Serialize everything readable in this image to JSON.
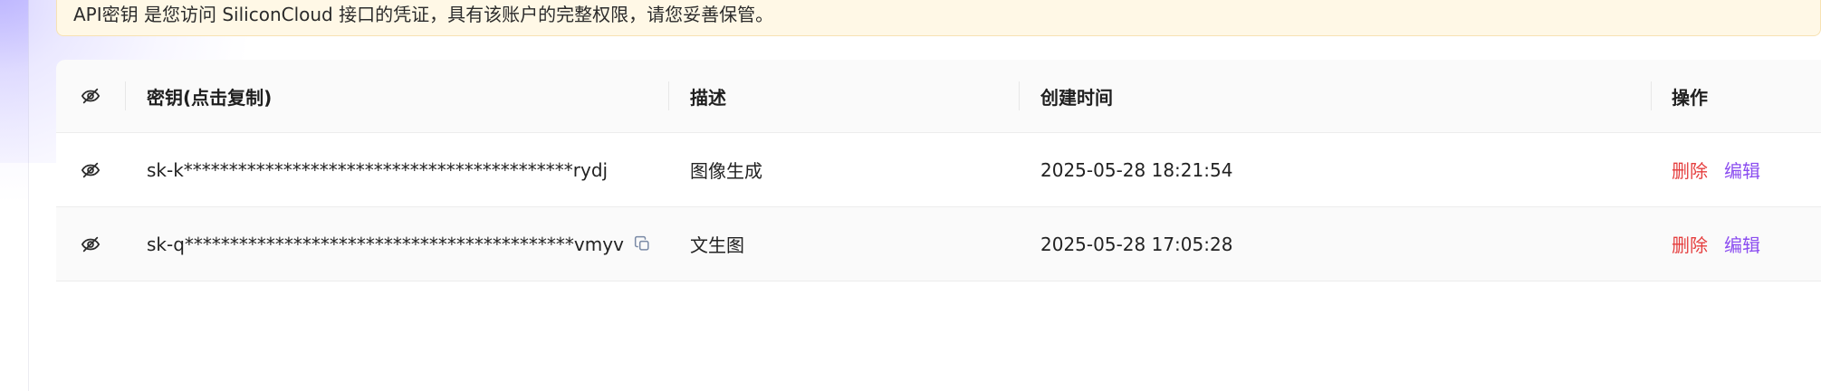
{
  "notice": {
    "text": "API密钥 是您访问 SiliconCloud 接口的凭证，具有该账户的完整权限，请您妥善保管。"
  },
  "table": {
    "header": {
      "key": "密钥(点击复制)",
      "description": "描述",
      "created_at": "创建时间",
      "actions": "操作"
    },
    "rows": [
      {
        "key": "sk-k*******************************************rydj",
        "description": "图像生成",
        "created_at": "2025-05-28 18:21:54",
        "delete": "删除",
        "edit": "编辑"
      },
      {
        "key": "sk-q*******************************************vmyv",
        "description": "文生图",
        "created_at": "2025-05-28 17:05:28",
        "delete": "删除",
        "edit": "编辑"
      }
    ]
  },
  "icons": {
    "header_visibility": "eye-off-icon",
    "row_visibility": "eye-off-icon",
    "copy": "copy-icon"
  },
  "colors": {
    "notice_bg": "#fff8e6",
    "notice_border": "#f7e2b3",
    "delete": "#e53e3e",
    "edit": "#8b4df0",
    "header_bg": "#fafafa",
    "divider": "#ececec"
  }
}
